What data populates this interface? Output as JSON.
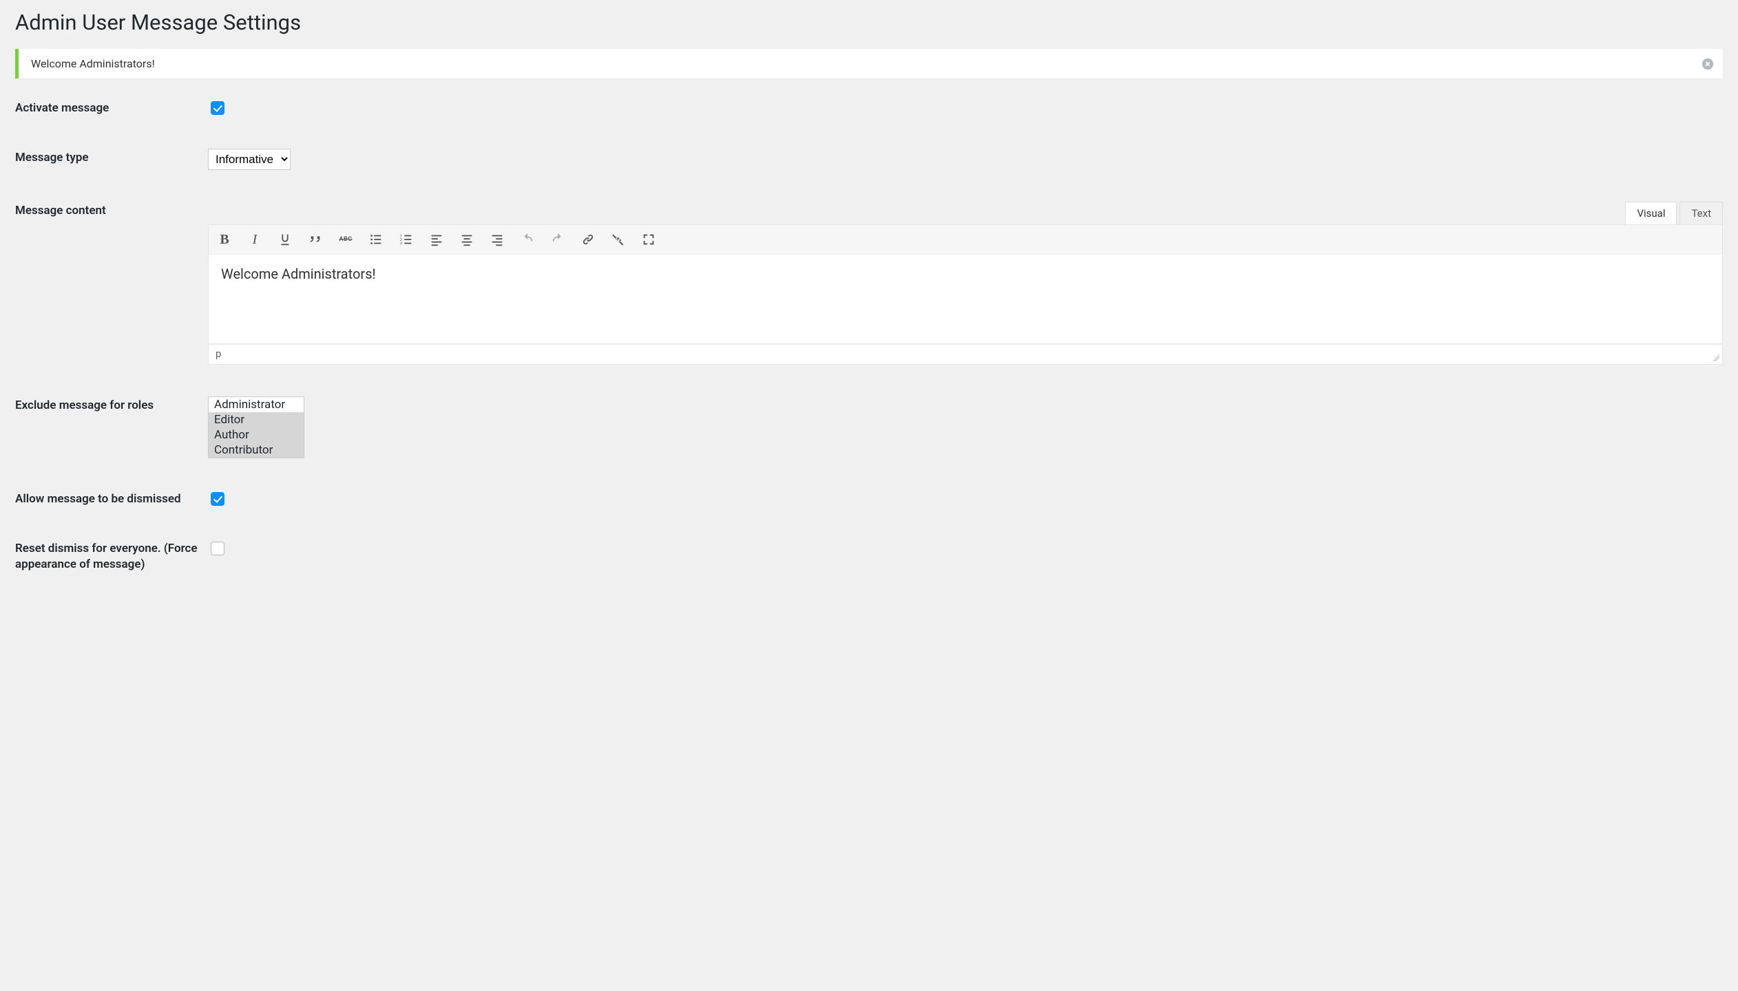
{
  "page": {
    "title": "Admin User Message Settings"
  },
  "notice": {
    "text": "Welcome Administrators!"
  },
  "fields": {
    "activate": {
      "label": "Activate message",
      "checked": true
    },
    "type": {
      "label": "Message type",
      "value": "Informative",
      "options": [
        "Informative"
      ]
    },
    "content": {
      "label": "Message content"
    },
    "exclude": {
      "label": "Exclude message for roles"
    },
    "dismiss": {
      "label": "Allow message to be dismissed",
      "checked": true
    },
    "reset": {
      "label": "Reset dismiss for everyone. (Force appearance of message)",
      "checked": false
    }
  },
  "editor": {
    "tabs": {
      "visual": "Visual",
      "text": "Text",
      "active": "visual"
    },
    "body": "Welcome Administrators!",
    "status_path": "p"
  },
  "roles": {
    "items": [
      {
        "label": "Administrator",
        "selected": false
      },
      {
        "label": "Editor",
        "selected": true
      },
      {
        "label": "Author",
        "selected": true
      },
      {
        "label": "Contributor",
        "selected": true
      }
    ]
  }
}
